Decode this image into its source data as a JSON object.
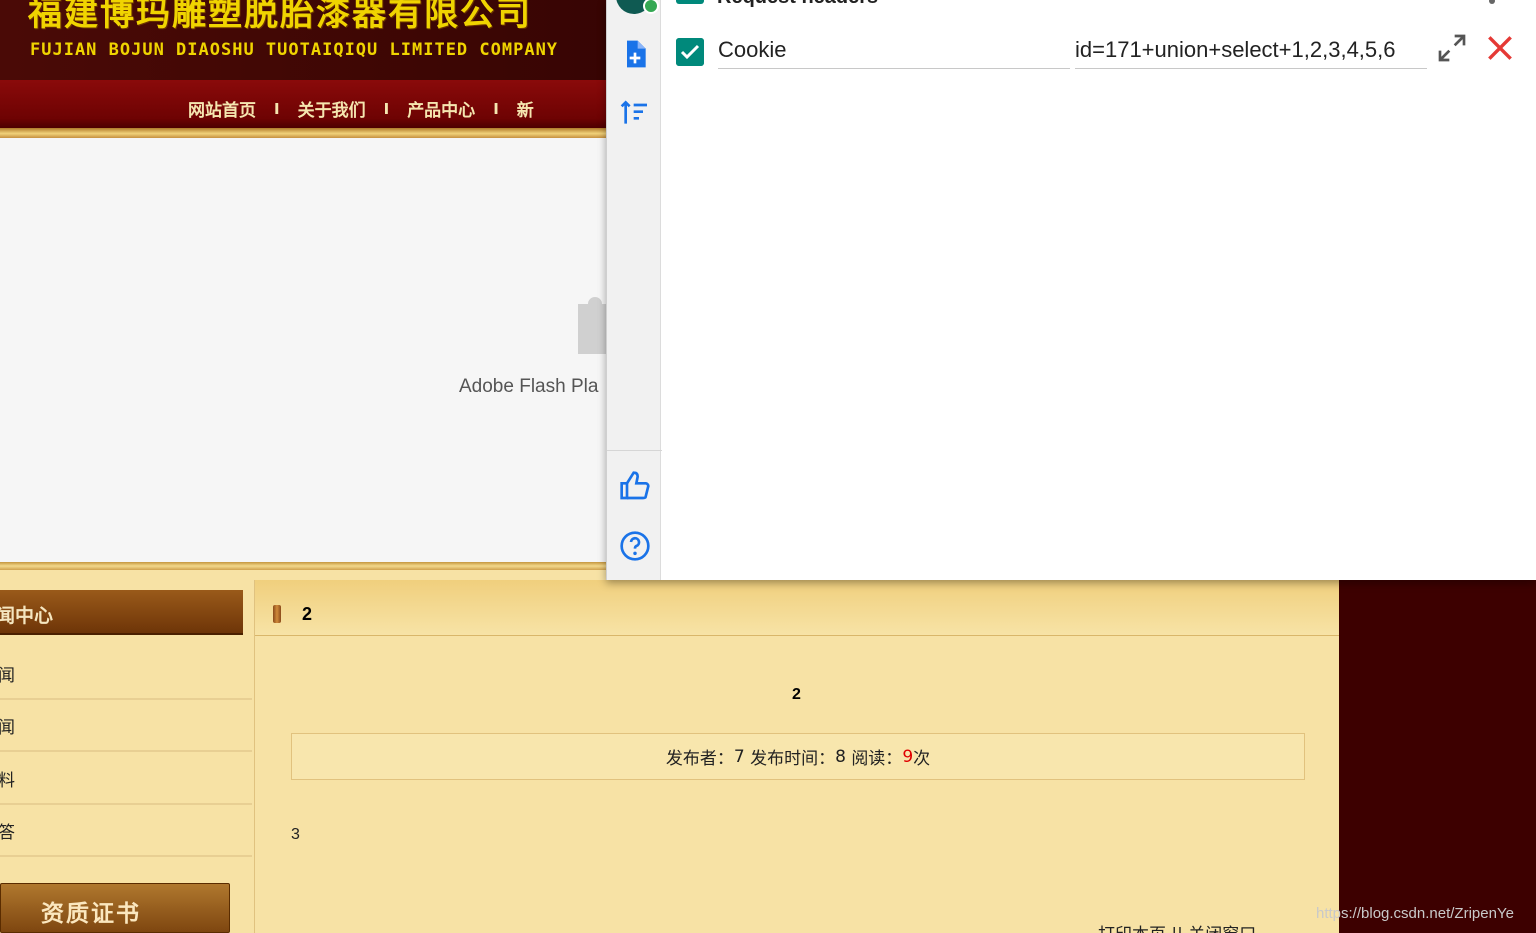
{
  "site": {
    "title_cn": "福建博玛雕塑脱胎漆器有限公司",
    "title_en": "FUJIAN BOJUN DIAOSHU  TUOTAIQIQU  LIMITED COMPANY",
    "nav": [
      "网站首页",
      "关于我们",
      "产品中心",
      "新"
    ],
    "nav_separator": "I",
    "flash_text": "Adobe Flash Pla",
    "sidebar_header": "闻中心",
    "sidebar_items": [
      "闻",
      "闻",
      "料",
      "答"
    ],
    "cert_button": "资质证书",
    "content_heading": "2",
    "article_title": "2",
    "meta": {
      "author_label": "发布者：",
      "author": "7",
      "time_label": "发布时间：",
      "time": "8",
      "read_label": "阅读：",
      "read_count": "9",
      "read_unit": "次"
    },
    "article_body": "3",
    "print_links": "打印本页 || 关闭窗口",
    "watermark": "https://blog.csdn.net/ZripenYe"
  },
  "popup": {
    "section_title": "Request headers",
    "header_row": {
      "enabled": true,
      "name": "Cookie",
      "value": "id=171+union+select+1,2,3,4,5,6"
    }
  },
  "colors": {
    "accent_teal": "#00897b",
    "icon_blue": "#1a73e8",
    "remove_red": "#e53935",
    "site_dark_red": "#3d0000",
    "site_gold": "#f0d400"
  },
  "icons": {
    "add": "file-plus-icon",
    "sort": "sort-icon",
    "like": "thumbs-up-icon",
    "help": "help-circle-icon",
    "expand": "expand-icon",
    "remove": "close-icon"
  }
}
